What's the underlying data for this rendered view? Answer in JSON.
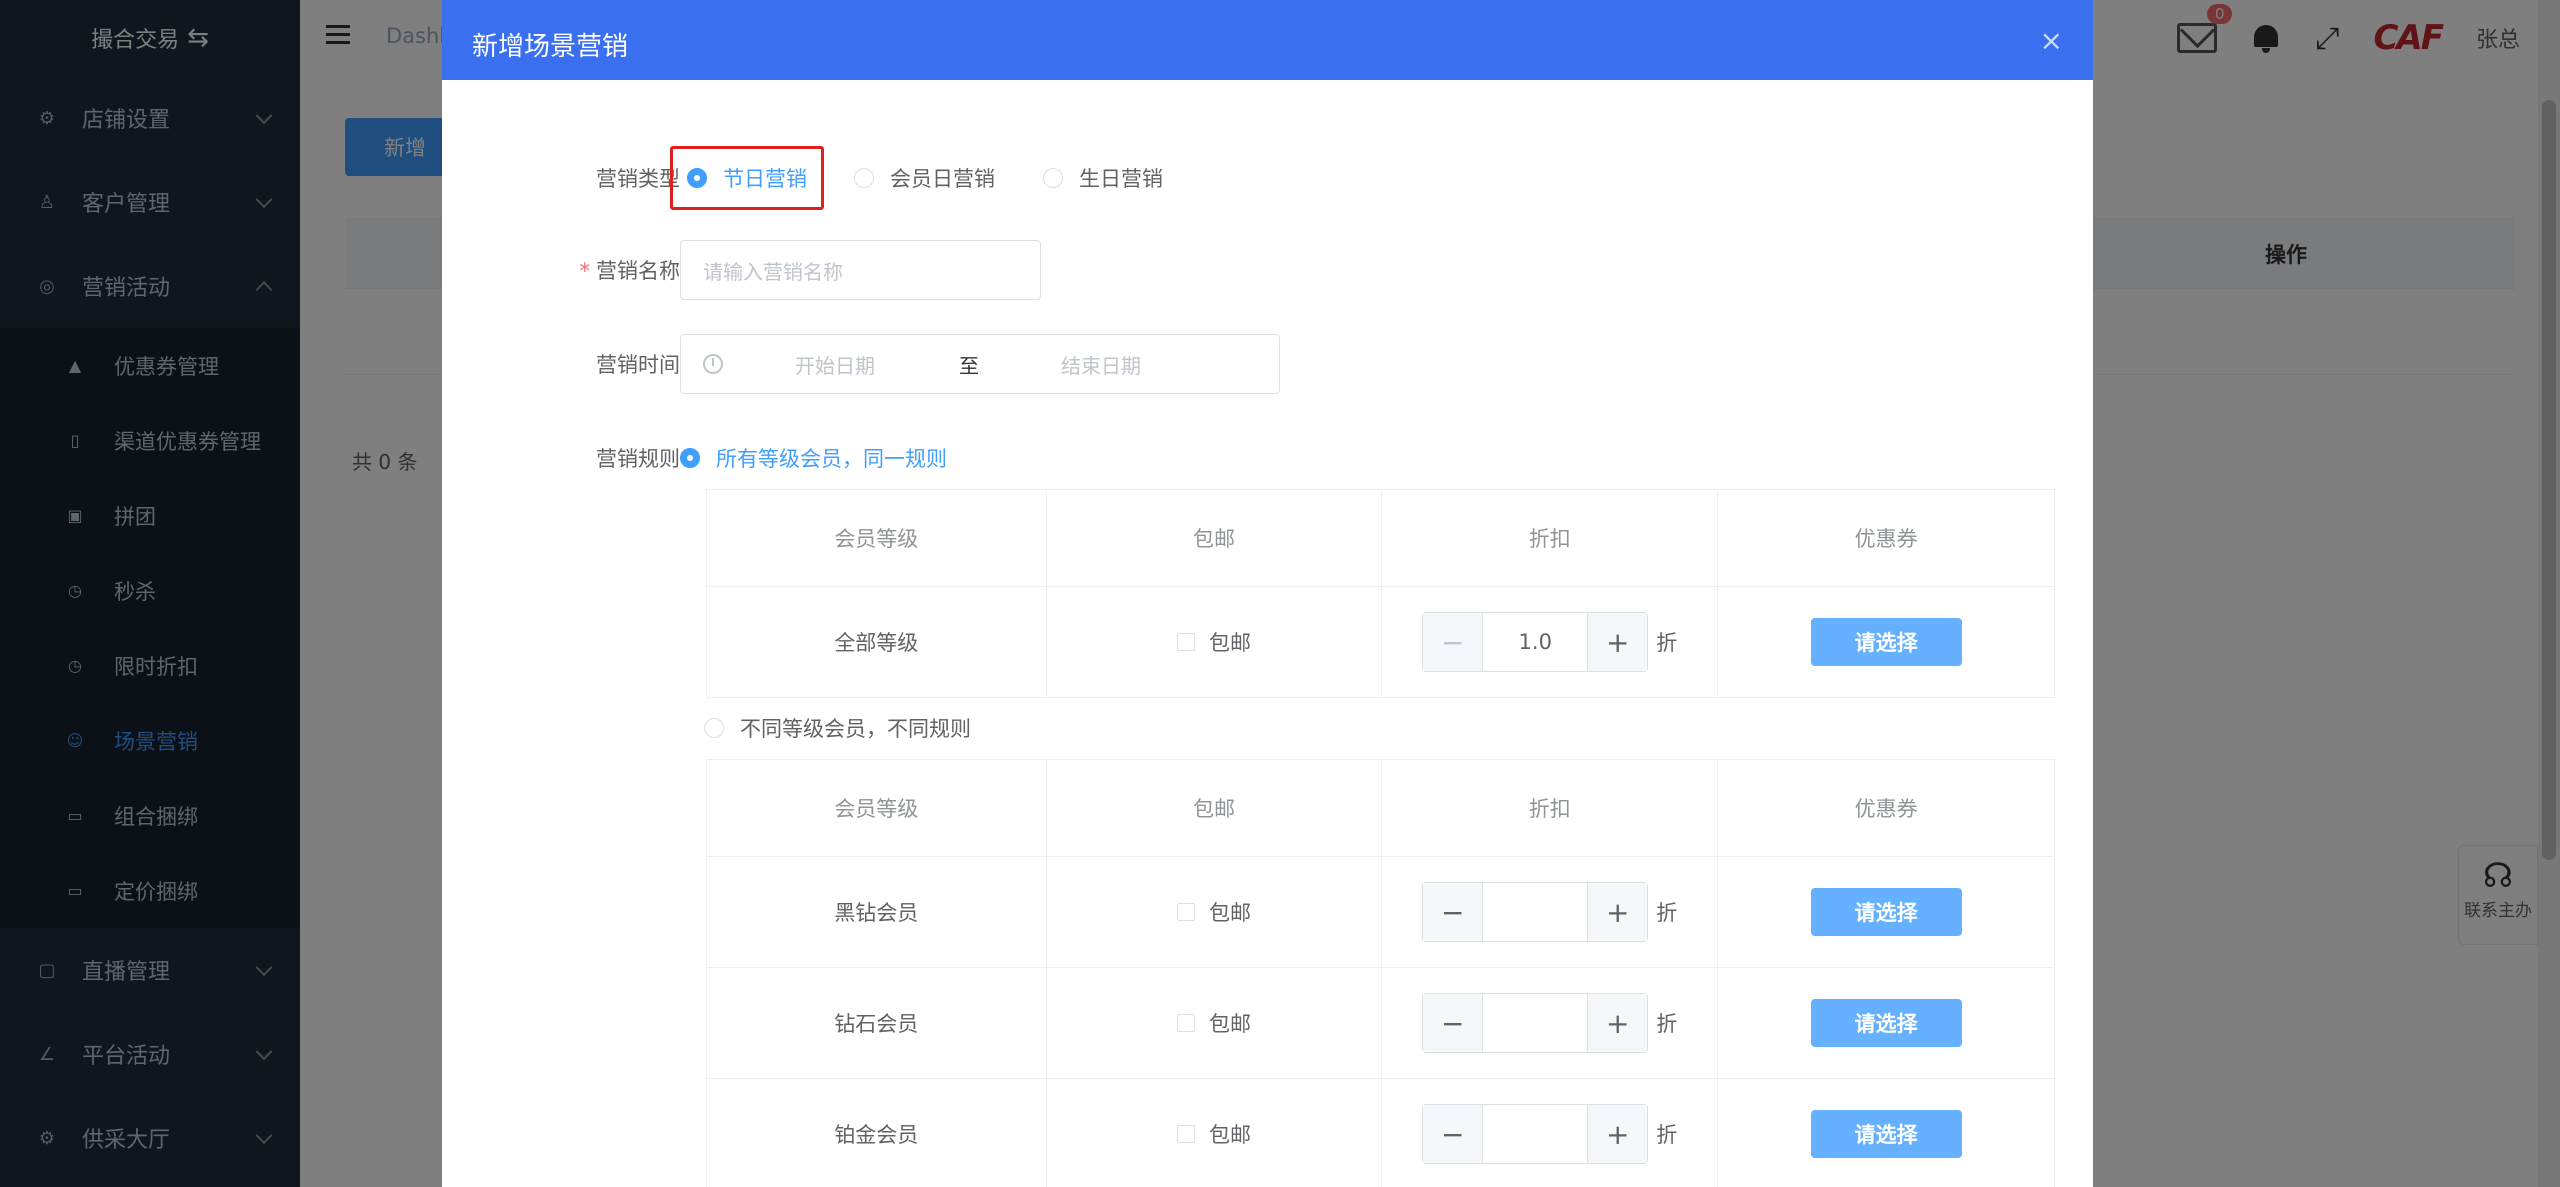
{
  "sidebar": {
    "logo_text": "撮合交易",
    "menus": [
      {
        "label": "店铺设置",
        "icon": "gear-icon"
      },
      {
        "label": "客户管理",
        "icon": "user-icon"
      },
      {
        "label": "营销活动",
        "icon": "compass-icon"
      }
    ],
    "submenu": [
      {
        "label": "优惠券管理",
        "icon": "bag-icon"
      },
      {
        "label": "渠道优惠券管理",
        "icon": "phone-icon"
      },
      {
        "label": "拼团",
        "icon": "briefcase-icon"
      },
      {
        "label": "秒杀",
        "icon": "alarm-clock-icon"
      },
      {
        "label": "限时折扣",
        "icon": "alarm-clock-icon"
      },
      {
        "label": "场景营销",
        "icon": "smile-icon",
        "active": true
      },
      {
        "label": "组合捆绑",
        "icon": "box-icon"
      },
      {
        "label": "定价捆绑",
        "icon": "box-icon"
      }
    ],
    "menus_bottom": [
      {
        "label": "直播管理",
        "icon": "video-icon"
      },
      {
        "label": "平台活动",
        "icon": "chart-icon"
      },
      {
        "label": "供采大厅",
        "icon": "gear-icon"
      }
    ]
  },
  "header": {
    "breadcrumb": "Dashb",
    "badge_count": "0",
    "brand": "CAF",
    "user": "张总"
  },
  "main": {
    "add_button": "新增",
    "column_op": "操作",
    "total": "共 0 条"
  },
  "contact": "联系主办",
  "dialog": {
    "title": "新增场景营销",
    "close": "×",
    "type_label": "营销类型",
    "type_options": [
      "节日营销",
      "会员日营销",
      "生日营销"
    ],
    "type_selected": "节日营销",
    "name_label": "营销名称",
    "name_placeholder": "请输入营销名称",
    "time_label": "营销时间",
    "time_start": "开始日期",
    "time_sep": "至",
    "time_end": "结束日期",
    "rule_label": "营销规则",
    "rule_same": "所有等级会员，同一规则",
    "rule_diff": "不同等级会员，不同规则",
    "columns": [
      "会员等级",
      "包邮",
      "折扣",
      "优惠券"
    ],
    "free_shipping": "包邮",
    "discount_unit": "折",
    "pick_label": "请选择",
    "same_rows": [
      {
        "level": "全部等级",
        "discount": "1.0"
      }
    ],
    "diff_rows": [
      {
        "level": "黑钻会员",
        "discount": ""
      },
      {
        "level": "钻石会员",
        "discount": ""
      },
      {
        "level": "铂金会员",
        "discount": ""
      }
    ]
  }
}
